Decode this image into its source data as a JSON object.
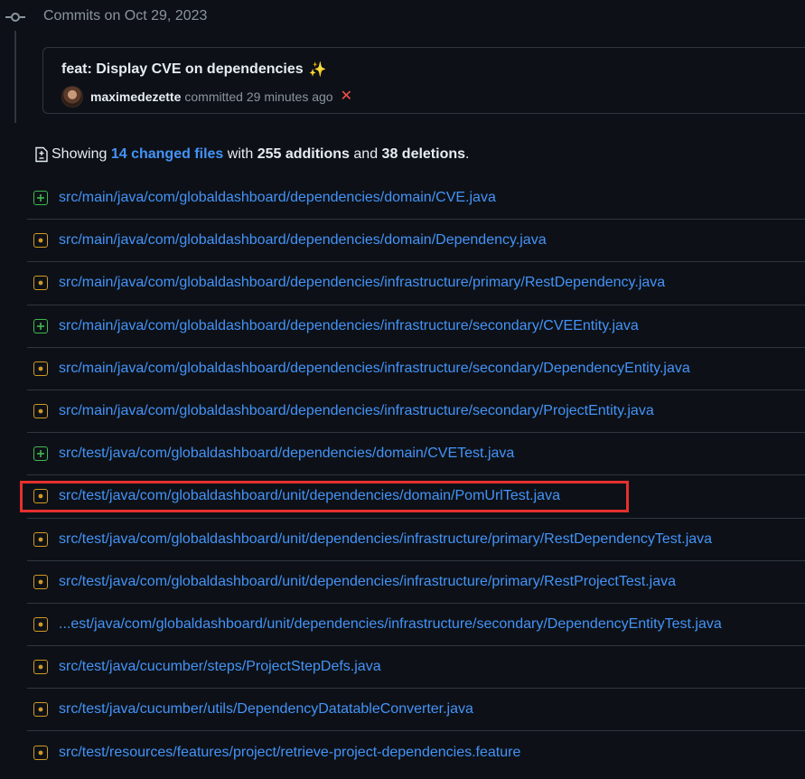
{
  "timeline": {
    "date_heading": "Commits on Oct 29, 2023",
    "node_icon": "git-commit-icon"
  },
  "commit": {
    "title": "feat: Display CVE on dependencies",
    "title_emoji": "✨",
    "author": "maximedezette",
    "action": "committed",
    "time": "29 minutes ago",
    "status_icon": "x-icon",
    "status_color": "#f85149"
  },
  "summary": {
    "prefix": "Showing",
    "changed_files": "14 changed files",
    "with": "with",
    "additions": "255 additions",
    "and": "and",
    "deletions": "38 deletions",
    "suffix": "."
  },
  "colors": {
    "background": "#0d1117",
    "link": "#4493f8",
    "added": "#3fb950",
    "modified": "#d29922",
    "highlight": "#e5302e"
  },
  "files": [
    {
      "status": "added",
      "path": "src/main/java/com/globaldashboard/dependencies/domain/CVE.java"
    },
    {
      "status": "modified",
      "path": "src/main/java/com/globaldashboard/dependencies/domain/Dependency.java"
    },
    {
      "status": "modified",
      "path": "src/main/java/com/globaldashboard/dependencies/infrastructure/primary/RestDependency.java"
    },
    {
      "status": "added",
      "path": "src/main/java/com/globaldashboard/dependencies/infrastructure/secondary/CVEEntity.java"
    },
    {
      "status": "modified",
      "path": "src/main/java/com/globaldashboard/dependencies/infrastructure/secondary/DependencyEntity.java"
    },
    {
      "status": "modified",
      "path": "src/main/java/com/globaldashboard/dependencies/infrastructure/secondary/ProjectEntity.java"
    },
    {
      "status": "added",
      "path": "src/test/java/com/globaldashboard/dependencies/domain/CVETest.java"
    },
    {
      "status": "modified",
      "path": "src/test/java/com/globaldashboard/unit/dependencies/domain/PomUrlTest.java",
      "highlighted": true
    },
    {
      "status": "modified",
      "path": "src/test/java/com/globaldashboard/unit/dependencies/infrastructure/primary/RestDependencyTest.java"
    },
    {
      "status": "modified",
      "path": "src/test/java/com/globaldashboard/unit/dependencies/infrastructure/primary/RestProjectTest.java"
    },
    {
      "status": "modified",
      "path": "...est/java/com/globaldashboard/unit/dependencies/infrastructure/secondary/DependencyEntityTest.java"
    },
    {
      "status": "modified",
      "path": "src/test/java/cucumber/steps/ProjectStepDefs.java"
    },
    {
      "status": "modified",
      "path": "src/test/java/cucumber/utils/DependencyDatatableConverter.java"
    },
    {
      "status": "modified",
      "path": "src/test/resources/features/project/retrieve-project-dependencies.feature"
    }
  ]
}
